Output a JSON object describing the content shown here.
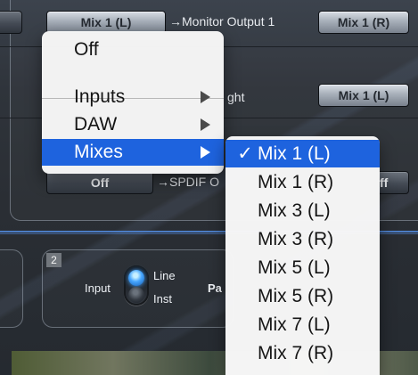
{
  "routing": {
    "row1_source": "Mix 1 (L)",
    "row1_destination": "→Monitor Output 1",
    "row1_right": "Mix 1 (R)",
    "row2_partial_destination": "ght",
    "row2_right": "Mix 1 (L)",
    "row3_source": "Off",
    "row3_destination": "→SPDIF O",
    "row3_right_partial": "ff"
  },
  "menu": {
    "items": [
      {
        "label": "Off",
        "has_submenu": false
      },
      {
        "label": "Inputs",
        "has_submenu": true
      },
      {
        "label": "DAW",
        "has_submenu": true
      },
      {
        "label": "Mixes",
        "has_submenu": true,
        "selected": true
      }
    ]
  },
  "submenu": {
    "items": [
      {
        "label": "Mix 1 (L)",
        "checked": true,
        "check": "✓"
      },
      {
        "label": "Mix 1 (R)",
        "checked": false
      },
      {
        "label": "Mix 3 (L)",
        "checked": false
      },
      {
        "label": "Mix 3 (R)",
        "checked": false
      },
      {
        "label": "Mix 5 (L)",
        "checked": false
      },
      {
        "label": "Mix 5 (R)",
        "checked": false
      },
      {
        "label": "Mix 7 (L)",
        "checked": false
      },
      {
        "label": "Mix 7 (R)",
        "checked": false
      }
    ]
  },
  "channel": {
    "number": "2",
    "input_label": "Input",
    "line_label": "Line",
    "inst_label": "Inst",
    "partial_label": "Pa",
    "selected_input": "Line"
  },
  "colors": {
    "menu_highlight": "#1e63de",
    "blue_rule": "#4b7cc4",
    "active_led": "#47a6ff"
  },
  "icons": {
    "menu_arrow": "triangle-right-icon",
    "checkmark": "checkmark-icon"
  }
}
